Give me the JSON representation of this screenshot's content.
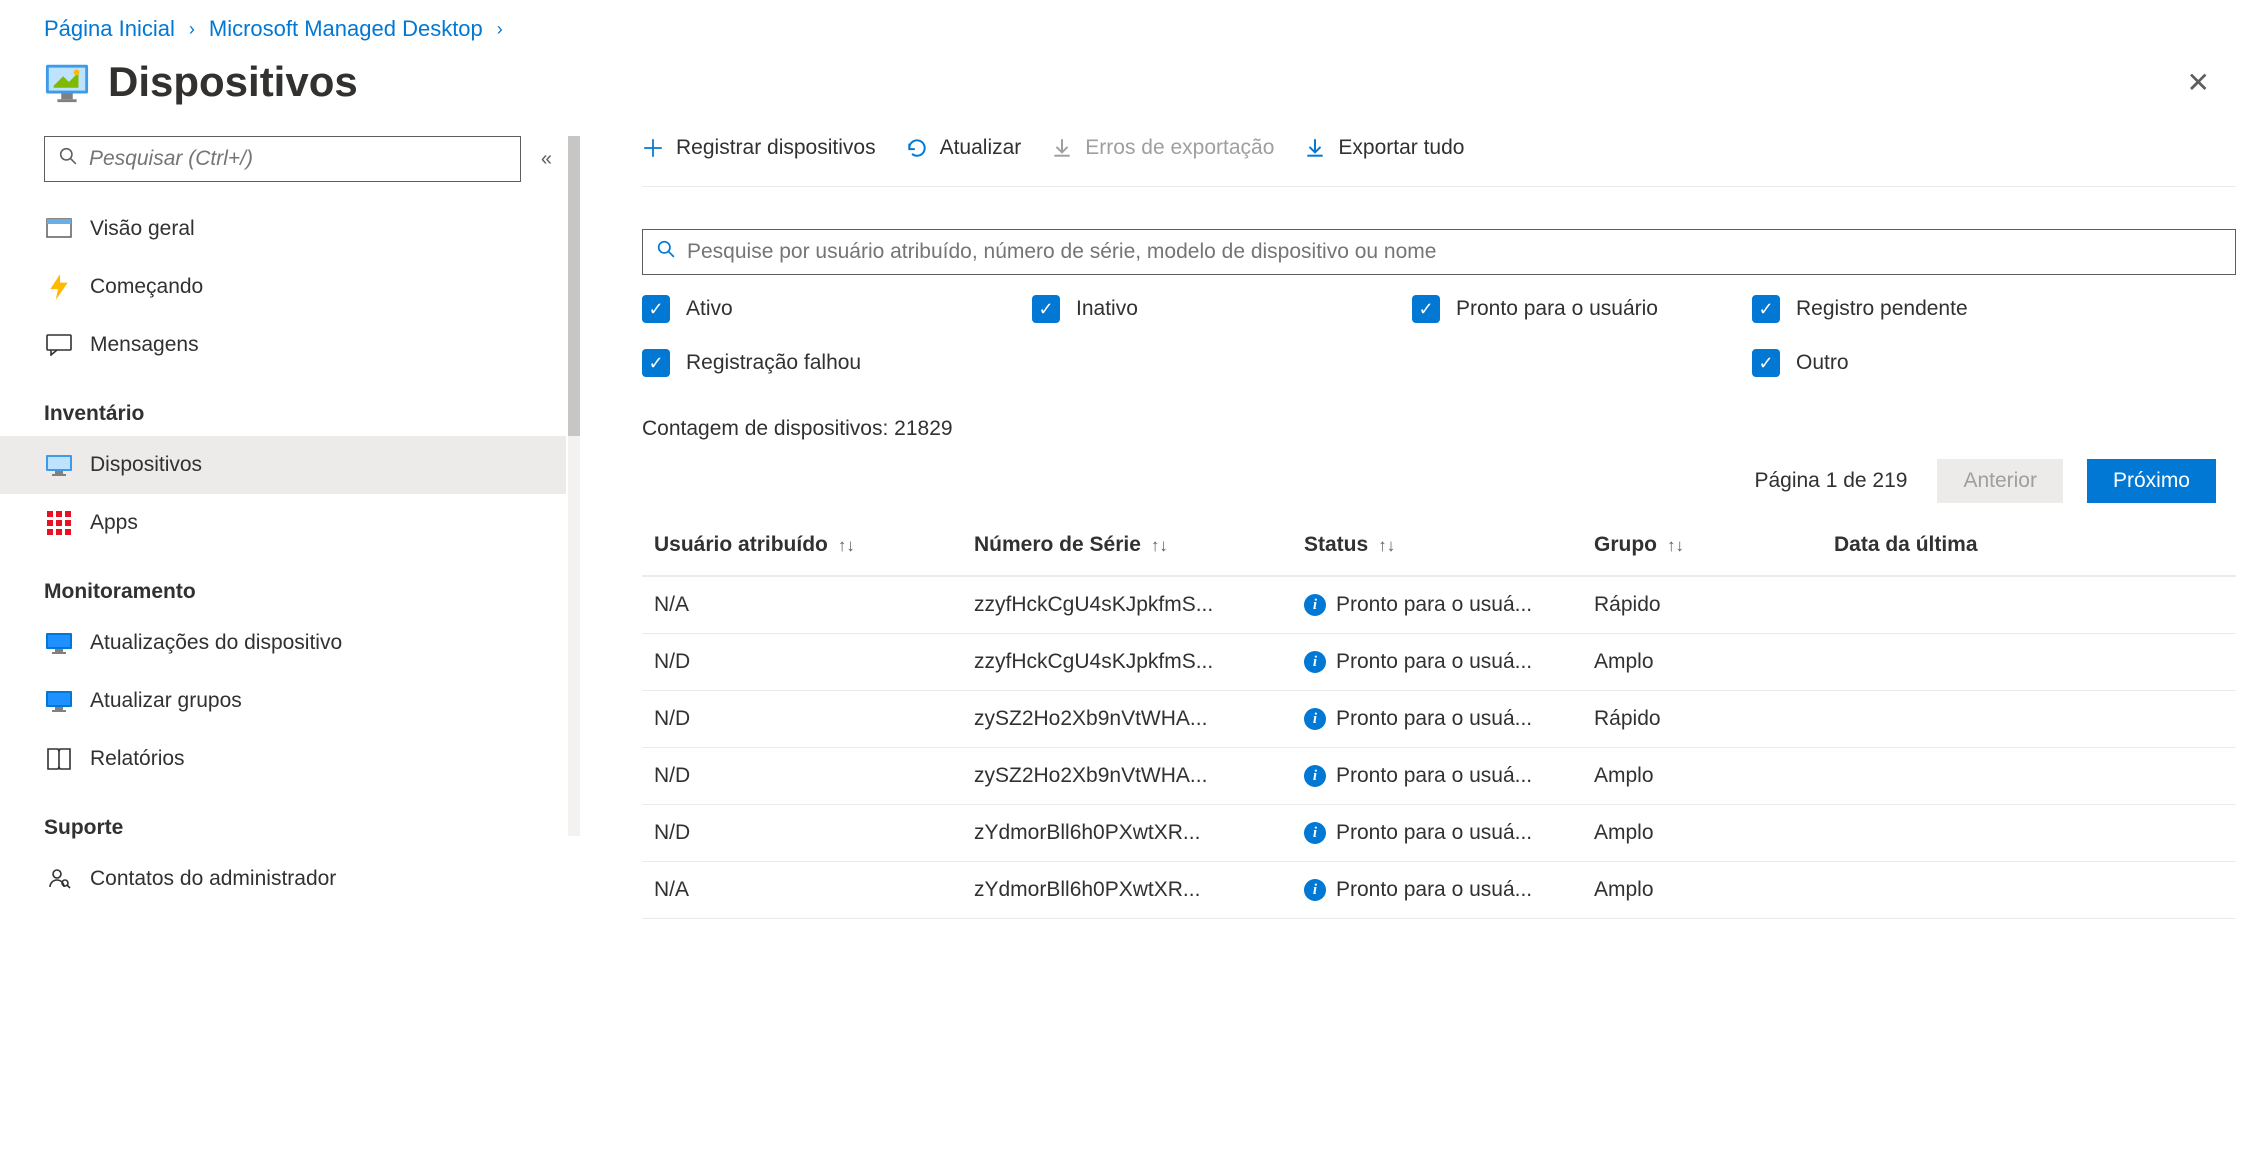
{
  "breadcrumb": {
    "home": "Página Inicial",
    "parent": "Microsoft Managed Desktop"
  },
  "page_title": "Dispositivos",
  "sidebar": {
    "search_placeholder": "Pesquisar (Ctrl+/)",
    "top": [
      {
        "label": "Visão geral",
        "icon": "overview"
      },
      {
        "label": "Começando",
        "icon": "bolt"
      },
      {
        "label": "Mensagens",
        "icon": "chat"
      }
    ],
    "sections": [
      {
        "title": "Inventário",
        "items": [
          {
            "label": "Dispositivos",
            "icon": "devices",
            "active": true
          },
          {
            "label": "Apps",
            "icon": "apps"
          }
        ]
      },
      {
        "title": "Monitoramento",
        "items": [
          {
            "label": "Atualizações do dispositivo",
            "icon": "monitor-blue"
          },
          {
            "label": "Atualizar grupos",
            "icon": "monitor-blue"
          },
          {
            "label": "Relatórios",
            "icon": "book"
          }
        ]
      },
      {
        "title": "Suporte",
        "items": [
          {
            "label": "Contatos do administrador",
            "icon": "person-search"
          }
        ]
      }
    ]
  },
  "toolbar": {
    "register": "Registrar dispositivos",
    "refresh": "Atualizar",
    "export_errors": "Erros de exportação",
    "export_all": "Exportar tudo"
  },
  "filter_search_placeholder": "Pesquise por usuário atribuído, número de série, modelo de dispositivo ou nome",
  "filters": {
    "active": "Ativo",
    "inactive": "Inativo",
    "ready": "Pronto para o usuário",
    "pending": "Registro pendente",
    "failed": "Registração falhou",
    "other": "Outro"
  },
  "count_label": "Contagem de dispositivos:",
  "count_value": "21829",
  "pager": {
    "info": "Página 1 de 219",
    "prev": "Anterior",
    "next": "Próximo"
  },
  "table": {
    "headers": {
      "user": "Usuário atribuído",
      "serial": "Número de Série",
      "status": "Status",
      "group": "Grupo",
      "last": "Data da última"
    },
    "rows": [
      {
        "user": "N/A",
        "serial": "zzyfHckCgU4sKJpkfmS...",
        "status": "Pronto para o usuá...",
        "group": "Rápido"
      },
      {
        "user": "N/D",
        "serial": "zzyfHckCgU4sKJpkfmS...",
        "status": "Pronto para o usuá...",
        "group": "Amplo"
      },
      {
        "user": "N/D",
        "serial": "zySZ2Ho2Xb9nVtWHA...",
        "status": "Pronto para o usuá...",
        "group": "Rápido"
      },
      {
        "user": "N/D",
        "serial": "zySZ2Ho2Xb9nVtWHA...",
        "status": "Pronto para o usuá...",
        "group": "Amplo"
      },
      {
        "user": "N/D",
        "serial": "zYdmorBll6h0PXwtXR...",
        "status": "Pronto para o usuá...",
        "group": "Amplo"
      },
      {
        "user": "N/A",
        "serial": "zYdmorBll6h0PXwtXR...",
        "status": "Pronto para o usuá...",
        "group": "Amplo"
      }
    ]
  }
}
